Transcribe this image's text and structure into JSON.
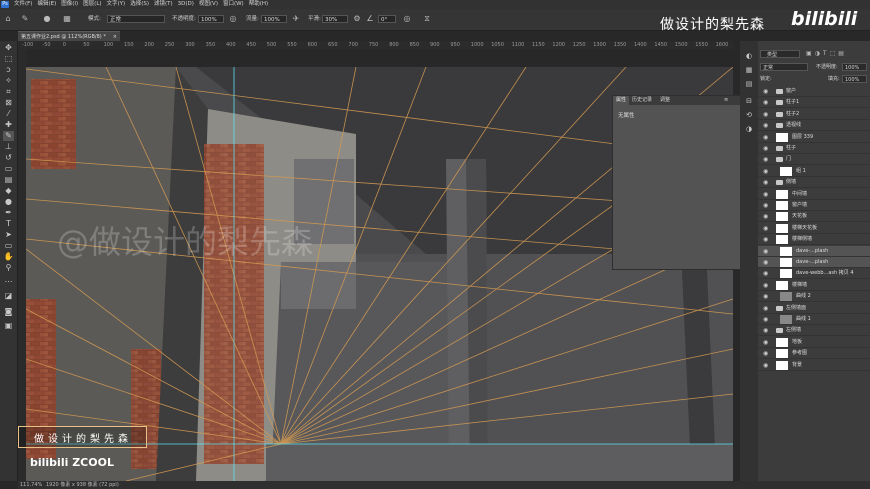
{
  "menubar": {
    "app_icon": "Ps",
    "items": [
      "文件(F)",
      "编辑(E)",
      "图像(I)",
      "图层(L)",
      "文字(Y)",
      "选择(S)",
      "滤镜(T)",
      "3D(D)",
      "视图(V)",
      "窗口(W)",
      "帮助(H)"
    ]
  },
  "options": {
    "mode_label": "模式:",
    "mode_value": "正常",
    "opacity_label": "不透明度:",
    "opacity_value": "100%",
    "flow_label": "流量:",
    "flow_value": "100%",
    "smooth_label": "平滑:",
    "smooth_value": "30%",
    "angle_value": "0°"
  },
  "document": {
    "tab_title": "第五课作业2.psd @ 112%(RGB/8) *",
    "close": "×"
  },
  "ruler": {
    "top_ticks": [
      "-100",
      "-50",
      "0",
      "50",
      "100",
      "150",
      "200",
      "250",
      "300",
      "350",
      "400",
      "450",
      "500",
      "550",
      "600",
      "650",
      "700",
      "750",
      "800",
      "850",
      "900",
      "950",
      "1000",
      "1050",
      "1100",
      "1150",
      "1200",
      "1250",
      "1300",
      "1350",
      "1400",
      "1450",
      "1500",
      "1550",
      "1600"
    ]
  },
  "status": {
    "zoom": "111.74%",
    "size": "1920 像素 x 938 像素 (72 ppi)"
  },
  "properties_panel": {
    "tabs": [
      "属性",
      "历史记录",
      "调整"
    ],
    "empty_text": "无属性"
  },
  "watermarks": {
    "top_text": "做设计的梨先森",
    "top_logo": "bilibili",
    "canvas_text": "@做设计的梨先森",
    "author_box": "做设计的梨先森",
    "bottom_logos": "bilibili  ZCOOL"
  },
  "layers_panel": {
    "kind_label": "类型",
    "blend_mode": "正常",
    "opacity_label": "不透明度:",
    "opacity_value": "100%",
    "lock_label": "锁定:",
    "fill_label": "填充:",
    "fill_value": "100%",
    "layers": [
      {
        "name": "窗户",
        "type": "folder",
        "indent": 1
      },
      {
        "name": "柱子1",
        "type": "folder",
        "indent": 1
      },
      {
        "name": "柱子2",
        "type": "folder",
        "indent": 1
      },
      {
        "name": "透视线",
        "type": "folder",
        "indent": 1
      },
      {
        "name": "图层 339",
        "type": "layer",
        "indent": 1
      },
      {
        "name": "柱子",
        "type": "folder",
        "indent": 1
      },
      {
        "name": "门",
        "type": "folder",
        "indent": 1
      },
      {
        "name": "组 1",
        "type": "layer",
        "indent": 2
      },
      {
        "name": "侧墙",
        "type": "folder",
        "indent": 1
      },
      {
        "name": "中间墙",
        "type": "layer",
        "indent": 1
      },
      {
        "name": "窗户墙",
        "type": "layer",
        "indent": 1
      },
      {
        "name": "天花板",
        "type": "layer",
        "indent": 1
      },
      {
        "name": "楼梯天花板",
        "type": "layer",
        "indent": 1
      },
      {
        "name": "楼梯侧墙",
        "type": "layer",
        "indent": 1
      },
      {
        "name": "dave-...plash",
        "type": "layer",
        "indent": 2,
        "selected": true
      },
      {
        "name": "dave-...plash",
        "type": "layer",
        "indent": 2,
        "selected": true
      },
      {
        "name": "dave-webb...ash 拷贝 4",
        "type": "layer",
        "indent": 2
      },
      {
        "name": "楼梯墙",
        "type": "layer",
        "indent": 1
      },
      {
        "name": "曲线 2",
        "type": "adjust",
        "indent": 2
      },
      {
        "name": "左侧墙面",
        "type": "folder",
        "indent": 1
      },
      {
        "name": "曲线 1",
        "type": "adjust",
        "indent": 2
      },
      {
        "name": "左侧墙",
        "type": "folder",
        "indent": 1
      },
      {
        "name": "地板",
        "type": "layer",
        "indent": 1
      },
      {
        "name": "参考图",
        "type": "layer",
        "indent": 1
      },
      {
        "name": "背景",
        "type": "layer",
        "indent": 1
      }
    ]
  }
}
